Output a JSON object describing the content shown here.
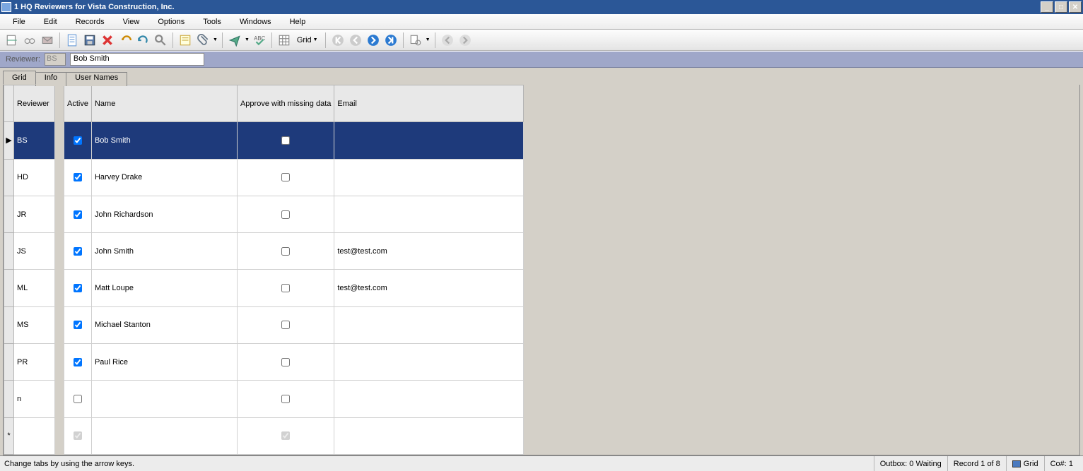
{
  "title": "1 HQ Reviewers for Vista Construction, Inc.",
  "menu": [
    "File",
    "Edit",
    "Records",
    "View",
    "Options",
    "Tools",
    "Windows",
    "Help"
  ],
  "toolbar_grid_label": "Grid",
  "reviewer_bar": {
    "label": "Reviewer:",
    "code": "BS",
    "name": "Bob Smith"
  },
  "tabs": [
    "Grid",
    "Info",
    "User Names"
  ],
  "columns_left": [
    "Reviewer"
  ],
  "columns_right": [
    "Active",
    "Name",
    "Approve with missing data",
    "Email"
  ],
  "rows": [
    {
      "reviewer": "BS",
      "active": true,
      "name": "Bob Smith",
      "approve": false,
      "email": "",
      "selected": true
    },
    {
      "reviewer": "HD",
      "active": true,
      "name": "Harvey Drake",
      "approve": false,
      "email": ""
    },
    {
      "reviewer": "JR",
      "active": true,
      "name": "John Richardson",
      "approve": false,
      "email": ""
    },
    {
      "reviewer": "JS",
      "active": true,
      "name": "John Smith",
      "approve": false,
      "email": "test@test.com"
    },
    {
      "reviewer": "ML",
      "active": true,
      "name": "Matt Loupe",
      "approve": false,
      "email": "test@test.com"
    },
    {
      "reviewer": "MS",
      "active": true,
      "name": "Michael Stanton",
      "approve": false,
      "email": ""
    },
    {
      "reviewer": "PR",
      "active": true,
      "name": "Paul Rice",
      "approve": false,
      "email": ""
    },
    {
      "reviewer": "n",
      "active": false,
      "name": "",
      "approve": false,
      "email": ""
    }
  ],
  "newrow": {
    "active_disabled": true,
    "approve_disabled": true
  },
  "status": {
    "help": "Change tabs by using the arrow keys.",
    "outbox": "Outbox: 0 Waiting",
    "record": "Record 1 of 8",
    "mode": "Grid",
    "co": "Co#: 1"
  }
}
